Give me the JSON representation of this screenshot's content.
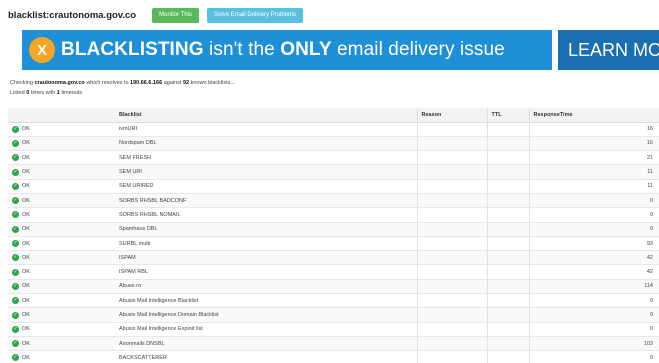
{
  "header": {
    "title": "blacklist:crautonoma.gov.co",
    "monitor_label": "Monitor This",
    "solve_label": "Solve Email Delivery Problems"
  },
  "banner": {
    "x_glyph": "X",
    "bold1": "BLACKLISTING",
    "text1": " isn't the ",
    "bold2": "ONLY",
    "text2": " email delivery issue",
    "learn_more": "LEARN MORE",
    "colors": {
      "background": "#1f8fd8",
      "badge": "#f5a623",
      "learn_bg": "#1a6fb0"
    }
  },
  "info": {
    "checking": "Checking ",
    "domain": "crautonoma.gov.co",
    "resolves": " which resolves to ",
    "ip": "190.66.6.166",
    "against": " against ",
    "count": "92",
    "known": " known blacklists...",
    "listed_prefix": "Listed ",
    "listed_count": "0",
    "times_with": " times with ",
    "timeouts_count": "1",
    "timeouts_label": " timeouts"
  },
  "table": {
    "columns": {
      "blacklist": "Blacklist",
      "reason": "Reason",
      "ttl": "TTL",
      "response": "ResponseTime"
    },
    "rows": [
      {
        "status": "OK",
        "blacklist": "ivmURI",
        "reason": "",
        "ttl": "",
        "response": "16"
      },
      {
        "status": "OK",
        "blacklist": "Nordspam DBL",
        "reason": "",
        "ttl": "",
        "response": "16"
      },
      {
        "status": "OK",
        "blacklist": "SEM FRESH",
        "reason": "",
        "ttl": "",
        "response": "21"
      },
      {
        "status": "OK",
        "blacklist": "SEM URI",
        "reason": "",
        "ttl": "",
        "response": "11"
      },
      {
        "status": "OK",
        "blacklist": "SEM URIRED",
        "reason": "",
        "ttl": "",
        "response": "11"
      },
      {
        "status": "OK",
        "blacklist": "SORBS RHSBL BADCONF",
        "reason": "",
        "ttl": "",
        "response": "0"
      },
      {
        "status": "OK",
        "blacklist": "SORBS RHSBL NOMAIL",
        "reason": "",
        "ttl": "",
        "response": "0"
      },
      {
        "status": "OK",
        "blacklist": "Spamhaus DBL",
        "reason": "",
        "ttl": "",
        "response": "0"
      },
      {
        "status": "OK",
        "blacklist": "SURBL multi",
        "reason": "",
        "ttl": "",
        "response": "93"
      },
      {
        "status": "OK",
        "blacklist": "ISPAM",
        "reason": "",
        "ttl": "",
        "response": "42"
      },
      {
        "status": "OK",
        "blacklist": "ISPAM RBL",
        "reason": "",
        "ttl": "",
        "response": "42"
      },
      {
        "status": "OK",
        "blacklist": "Abuse.ro",
        "reason": "",
        "ttl": "",
        "response": "114"
      },
      {
        "status": "OK",
        "blacklist": "Abusix Mail Intelligence Blacklist",
        "reason": "",
        "ttl": "",
        "response": "0"
      },
      {
        "status": "OK",
        "blacklist": "Abusix Mail Intelligence Domain Blacklist",
        "reason": "",
        "ttl": "",
        "response": "0"
      },
      {
        "status": "OK",
        "blacklist": "Abusix Mail Intelligence Exploit list",
        "reason": "",
        "ttl": "",
        "response": "0"
      },
      {
        "status": "OK",
        "blacklist": "Anonmails DNSBL",
        "reason": "",
        "ttl": "",
        "response": "103"
      },
      {
        "status": "OK",
        "blacklist": "BACKSCATTERER",
        "reason": "",
        "ttl": "",
        "response": "0"
      }
    ]
  }
}
